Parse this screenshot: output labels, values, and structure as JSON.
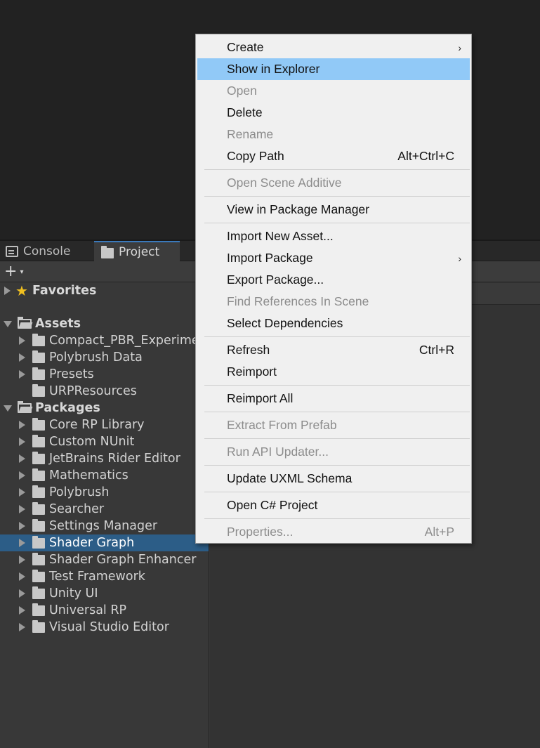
{
  "tabs": {
    "console": "Console",
    "project": "Project"
  },
  "toolbar": {
    "add": "+",
    "add_caret": "▾"
  },
  "tree": {
    "favorites": "Favorites",
    "assets": "Assets",
    "asset_items": [
      "Compact_PBR_Experime",
      "Polybrush Data",
      "Presets",
      "URPResources"
    ],
    "packages": "Packages",
    "package_items": [
      "Core RP Library",
      "Custom NUnit",
      "JetBrains Rider Editor",
      "Mathematics",
      "Polybrush",
      "Searcher",
      "Settings Manager",
      "Shader Graph",
      "Shader Graph Enhancer",
      "Test Framework",
      "Unity UI",
      "Universal RP",
      "Visual Studio Editor"
    ],
    "selected": "Shader Graph"
  },
  "menu": {
    "create": "Create",
    "show_in_explorer": "Show in Explorer",
    "open": "Open",
    "delete": "Delete",
    "rename": "Rename",
    "copy_path": "Copy Path",
    "copy_path_shortcut": "Alt+Ctrl+C",
    "open_scene_additive": "Open Scene Additive",
    "view_in_package_manager": "View in Package Manager",
    "import_new_asset": "Import New Asset...",
    "import_package": "Import Package",
    "export_package": "Export Package...",
    "find_references": "Find References In Scene",
    "select_dependencies": "Select Dependencies",
    "refresh": "Refresh",
    "refresh_shortcut": "Ctrl+R",
    "reimport": "Reimport",
    "reimport_all": "Reimport All",
    "extract_from_prefab": "Extract From Prefab",
    "run_api_updater": "Run API Updater...",
    "update_uxml_schema": "Update UXML Schema",
    "open_csharp_project": "Open C# Project",
    "properties": "Properties...",
    "properties_shortcut": "Alt+P",
    "submenu_arrow": "›"
  },
  "colors": {
    "highlight": "#91c9f7",
    "selection": "#2c5d87",
    "tab_accent": "#3a79bb"
  }
}
